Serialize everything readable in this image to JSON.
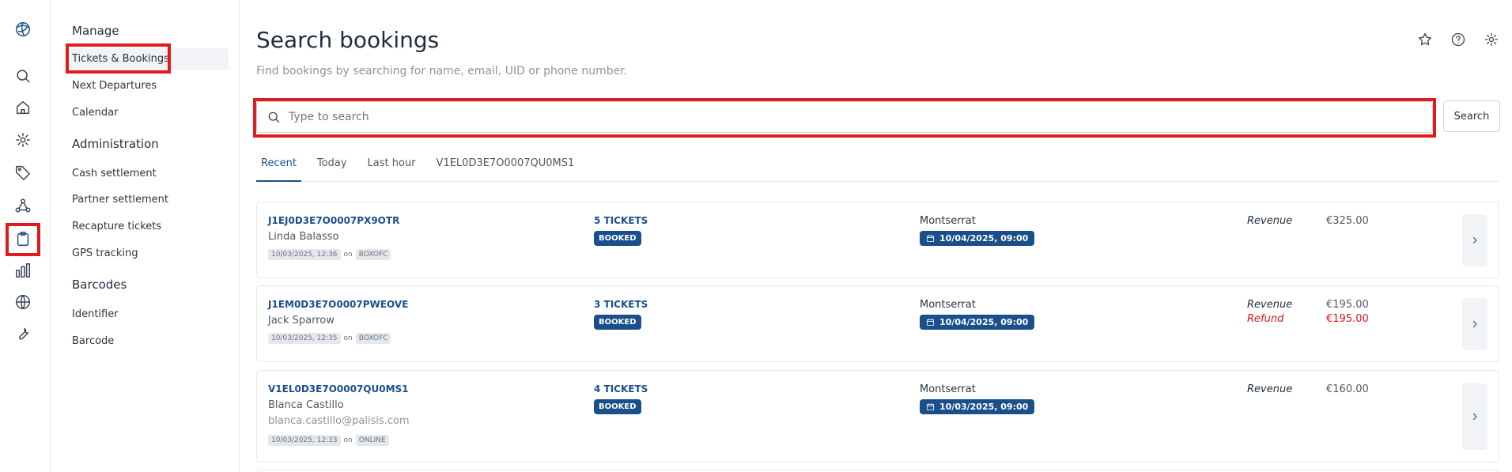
{
  "rail": {
    "icons": [
      "logo-icon",
      "search-icon",
      "home-icon",
      "gear-icon",
      "tag-icon",
      "network-icon",
      "clipboard-icon",
      "bar-chart-icon",
      "globe-icon",
      "wrench-icon"
    ]
  },
  "nav": {
    "manage_heading": "Manage",
    "manage_items": [
      "Tickets & Bookings",
      "Next Departures",
      "Calendar"
    ],
    "admin_heading": "Administration",
    "admin_items": [
      "Cash settlement",
      "Partner settlement",
      "Recapture tickets",
      "GPS tracking"
    ],
    "barcodes_heading": "Barcodes",
    "barcodes_items": [
      "Identifier",
      "Barcode"
    ]
  },
  "header": {
    "title": "Search bookings",
    "subtitle": "Find bookings by searching for name, email, UID or phone number."
  },
  "search": {
    "placeholder": "Type to search",
    "value": "",
    "button_label": "Search"
  },
  "tabs": [
    "Recent",
    "Today",
    "Last hour",
    "V1EL0D3E7O0007QU0MS1"
  ],
  "bookings": [
    {
      "uid": "J1EJ0D3E7O0007PX9OTR",
      "name": "Linda Balasso",
      "email": "",
      "created": "10/03/2025, 12:36",
      "on_label": "on",
      "channel": "BOXOFC",
      "tickets": "5 TICKETS",
      "status": "BOOKED",
      "destination": "Montserrat",
      "departure": "10/04/2025, 09:00",
      "revenue_label": "Revenue",
      "revenue": "€325.00",
      "refund_label": "",
      "refund": ""
    },
    {
      "uid": "J1EM0D3E7O0007PWEOVE",
      "name": "Jack Sparrow",
      "email": "",
      "created": "10/03/2025, 12:35",
      "on_label": "on",
      "channel": "BOXOFC",
      "tickets": "3 TICKETS",
      "status": "BOOKED",
      "destination": "Montserrat",
      "departure": "10/04/2025, 09:00",
      "revenue_label": "Revenue",
      "revenue": "€195.00",
      "refund_label": "Refund",
      "refund": "€195.00"
    },
    {
      "uid": "V1EL0D3E7O0007QU0MS1",
      "name": "Blanca Castillo",
      "email": "blanca.castillo@palisis.com",
      "created": "10/03/2025, 12:33",
      "on_label": "on",
      "channel": "ONLINE",
      "tickets": "4 TICKETS",
      "status": "BOOKED",
      "destination": "Montserrat",
      "departure": "10/03/2025, 09:00",
      "revenue_label": "Revenue",
      "revenue": "€160.00",
      "refund_label": "",
      "refund": ""
    }
  ],
  "colors": {
    "accent": "#1a4f8b",
    "highlight": "#e11b1b",
    "refund": "#d9141c"
  }
}
